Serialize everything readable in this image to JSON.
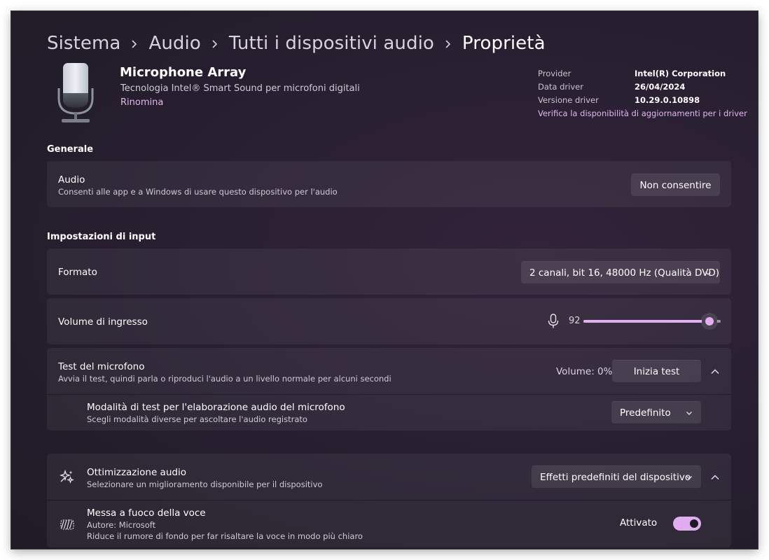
{
  "breadcrumb": {
    "items": [
      "Sistema",
      "Audio",
      "Tutti i dispositivi audio"
    ],
    "current": "Proprietà"
  },
  "device": {
    "name": "Microphone Array",
    "description": "Tecnologia Intel® Smart Sound per microfoni digitali",
    "rename_link": "Rinomina",
    "icon": "microphone-illustration"
  },
  "driver": {
    "provider_label": "Provider",
    "provider_value": "Intel(R) Corporation",
    "date_label": "Data driver",
    "date_value": "26/04/2024",
    "version_label": "Versione driver",
    "version_value": "10.29.0.10898",
    "update_link": "Verifica la disponibilità di aggiornamenti per i driver"
  },
  "general": {
    "section_title": "Generale",
    "audio_title": "Audio",
    "audio_subtitle": "Consenti alle app e a Windows di usare questo dispositivo per l'audio",
    "audio_button": "Non consentire"
  },
  "input": {
    "section_title": "Impostazioni di input",
    "format_label": "Formato",
    "format_value": "2 canali, bit 16, 48000 Hz (Qualità DVD)",
    "volume_label": "Volume di ingresso",
    "volume_value": "92",
    "volume_level": 92,
    "volume_icon": "microphone-icon",
    "mic_test_title": "Test del microfono",
    "mic_test_subtitle": "Avvia il test, quindi parla o riproduci l'audio a un livello normale per alcuni secondi",
    "mic_test_volume": "Volume: 0%",
    "mic_test_button": "Inizia test",
    "test_mode_title": "Modalità di test per l'elaborazione audio del microfono",
    "test_mode_subtitle": "Scegli modalità diverse per ascoltare l'audio registrato",
    "test_mode_value": "Predefinito"
  },
  "enhancements": {
    "title": "Ottimizzazione audio",
    "subtitle": "Selezionare un miglioramento disponibile per il dispositivo",
    "value": "Effetti predefiniti del dispositivo",
    "icon": "sparkle-icon",
    "voice_focus_title": "Messa a fuoco della voce",
    "voice_focus_author": "Autore: Microsoft",
    "voice_focus_desc": "Riduce il rumore di fondo per far risaltare la voce in modo più chiaro",
    "voice_focus_state": "Attivato",
    "voice_focus_on": true,
    "voice_focus_icon": "voice-waves-icon"
  },
  "colors": {
    "accent": "#e3b0ef",
    "link": "#e3b6f0",
    "background": "#2a2033"
  }
}
